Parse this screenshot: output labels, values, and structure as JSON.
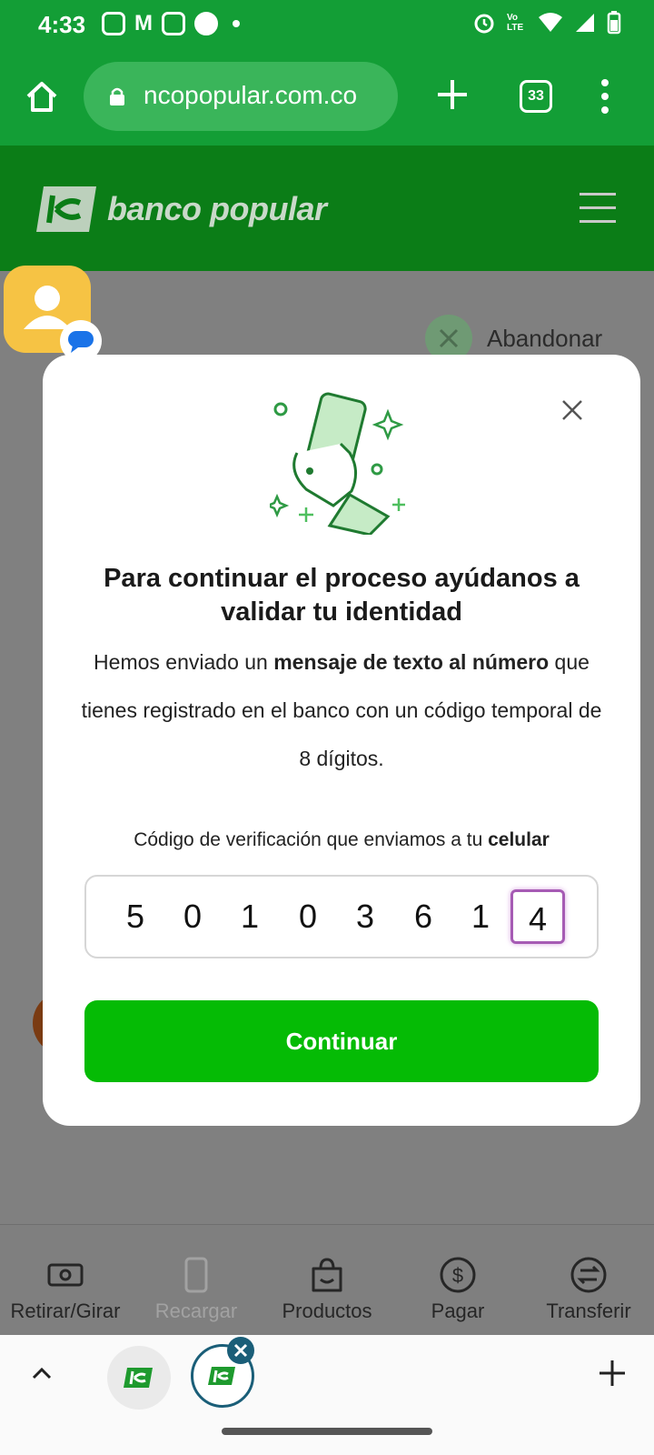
{
  "status_bar": {
    "time": "4:33",
    "notification_icons": [
      "instagram-icon",
      "gmail-icon",
      "instagram-icon",
      "s-app-icon",
      "dot-icon"
    ],
    "system_icons": [
      "alarm-icon",
      "volte-icon",
      "wifi-icon",
      "signal-icon",
      "battery-icon"
    ],
    "volte_label": "Vo LTE"
  },
  "browser": {
    "url": "ncopopular.com.co",
    "tab_count": "33"
  },
  "site": {
    "logo_text": "banco popular"
  },
  "page": {
    "abandon_label": "Abandonar"
  },
  "modal": {
    "title": "Para continuar el proceso ayúdanos a validar tu identidad",
    "body": {
      "part1": "Hemos enviado un ",
      "bold1": "mensaje de texto al número",
      "part2": " que tienes registrado en el banco con un código temporal de 8 dígitos."
    },
    "code_label": {
      "text": "Código de verificación que enviamos a tu ",
      "bold": "celular"
    },
    "code_digits": [
      "5",
      "0",
      "1",
      "0",
      "3",
      "6",
      "1",
      "4"
    ],
    "active_digit_index": 7,
    "continue_label": "Continuar"
  },
  "bottom_nav": {
    "items": [
      {
        "label": "Retirar/Girar",
        "icon": "cash-icon",
        "disabled": false
      },
      {
        "label": "Recargar",
        "icon": "phone-icon",
        "disabled": true
      },
      {
        "label": "Productos",
        "icon": "smile-bag-icon",
        "disabled": false
      },
      {
        "label": "Pagar",
        "icon": "dollar-icon",
        "disabled": false
      },
      {
        "label": "Transferir",
        "icon": "transfer-icon",
        "disabled": false
      }
    ]
  },
  "colors": {
    "browser_green": "#139e36",
    "header_green": "#0b7d17",
    "button_green": "#05bb05",
    "active_digit_border": "#a65bb4"
  }
}
